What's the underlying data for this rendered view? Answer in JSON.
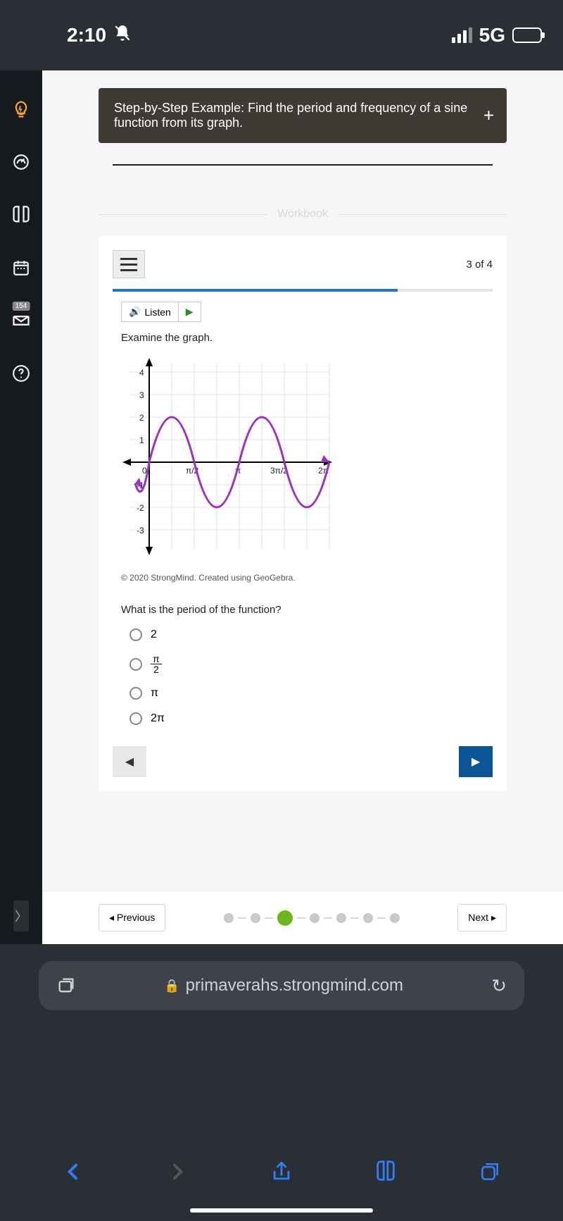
{
  "status": {
    "time": "2:10",
    "network": "5G"
  },
  "sidebar": {
    "badge": "154"
  },
  "example": {
    "title": "Step-by-Step Example: Find the period and frequency of a sine function from its graph."
  },
  "section": {
    "label": "Workbook"
  },
  "workbook": {
    "counter": "3 of 4",
    "listen": "Listen",
    "instruction": "Examine the graph.",
    "copyright": "© 2020 StrongMind. Created using GeoGebra.",
    "question": "What is the period of the function?",
    "options": {
      "a": "2",
      "b_num": "π",
      "b_den": "2",
      "c": "π",
      "d": "2π"
    }
  },
  "pager": {
    "prev": "Previous",
    "next": "Next"
  },
  "browser": {
    "url": "primaverahs.strongmind.com"
  },
  "chart_data": {
    "type": "line",
    "title": "",
    "xlabel": "",
    "ylabel": "",
    "xlim": [
      -0.3,
      6.6
    ],
    "ylim": [
      -3.5,
      4.5
    ],
    "x_ticks": [
      0,
      1.5708,
      3.1416,
      4.7124,
      6.2832
    ],
    "x_tick_labels": [
      "0",
      "π/2",
      "π",
      "3π/2",
      "2π"
    ],
    "y_ticks": [
      -3,
      -2,
      -1,
      1,
      2,
      3,
      4
    ],
    "series": [
      {
        "name": "sine-like curve",
        "color": "#9b2fc6",
        "description": "Periodic curve with amplitude 2, period π; first visible minimum near x≈0, maximum ≈2 near x≈π/4, minimum ≈-2 near x≈3π/4, repeating; 2 full waves between 0 and 2π.",
        "approx_points": [
          [
            -0.2,
            -1.5
          ],
          [
            0,
            0
          ],
          [
            0.7854,
            2
          ],
          [
            1.5708,
            0
          ],
          [
            2.3562,
            -2
          ],
          [
            3.1416,
            0
          ],
          [
            3.927,
            2
          ],
          [
            4.7124,
            0
          ],
          [
            5.4978,
            -2
          ],
          [
            6.2832,
            0
          ],
          [
            6.5,
            1.2
          ]
        ]
      }
    ]
  }
}
